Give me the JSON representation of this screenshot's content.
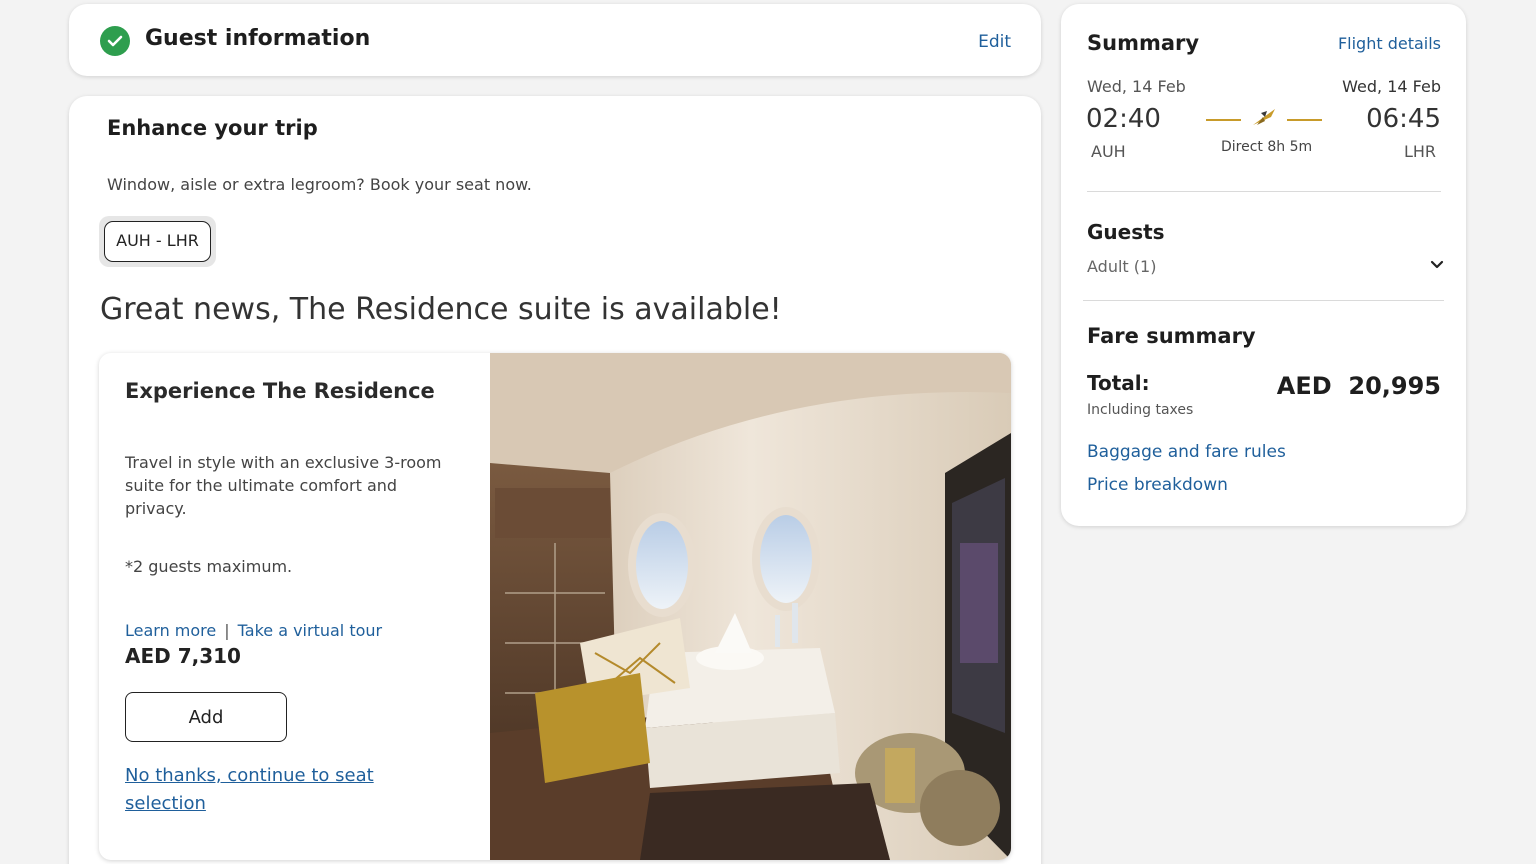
{
  "guest_section": {
    "title": "Guest information",
    "edit_label": "Edit",
    "status_icon": "check-circle-icon",
    "status_color": "#2e9e4e"
  },
  "enhance": {
    "title": "Enhance your trip",
    "subtitle": "Window, aisle or extra legroom? Book your seat now.",
    "route_chip": "AUH - LHR",
    "headline": "Great news, The Residence suite is available!",
    "offer": {
      "title": "Experience The Residence",
      "description": "Travel in style with an exclusive 3-room suite for the ultimate comfort and privacy.",
      "max_guests": "*2 guests maximum.",
      "learn_more": "Learn more",
      "separator": "|",
      "virtual_tour": "Take a virtual tour",
      "price": "AED 7,310",
      "add_label": "Add",
      "decline_label": "No thanks, continue to seat selection"
    }
  },
  "summary": {
    "title": "Summary",
    "flight_details_link": "Flight details",
    "departure": {
      "date": "Wed, 14 Feb",
      "time": "02:40",
      "airport": "AUH"
    },
    "arrival": {
      "date": "Wed, 14 Feb",
      "time": "06:45",
      "airport": "LHR"
    },
    "duration": "Direct 8h 5m",
    "guests_title": "Guests",
    "guests_value": "Adult (1)",
    "fare_title": "Fare summary",
    "total_label": "Total:",
    "total_amount": "AED  20,995",
    "tax_note": "Including taxes",
    "baggage_link": "Baggage and fare rules",
    "price_breakdown_link": "Price breakdown"
  },
  "colors": {
    "link": "#1f5f9b",
    "accent_gold": "#c89b2a",
    "success": "#2e9e4e"
  }
}
